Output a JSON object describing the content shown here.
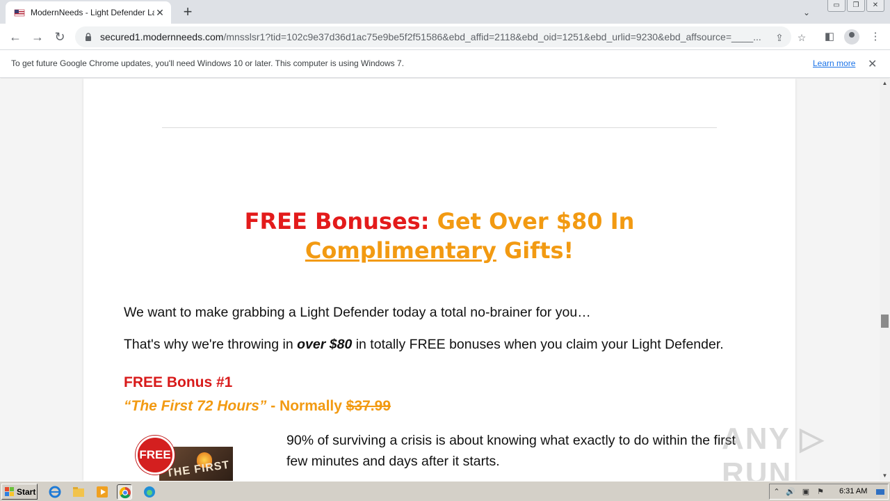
{
  "browser": {
    "tab": {
      "title": "ModernNeeds - Light Defender Laser",
      "close": "✕"
    },
    "new_tab": "+",
    "window_buttons": [
      "▭",
      "❐",
      "✕"
    ],
    "tab_search": "⌄",
    "nav": {
      "back": "←",
      "forward": "→",
      "reload": "↻"
    },
    "url": {
      "host": "secured1.modernneeds.com",
      "path": "/mnsslsr1?tid=102c9e37d36d1ac75e9be5f2f51586&ebd_affid=2118&ebd_oid=1251&ebd_urlid=9230&ebd_affsource=____..."
    },
    "icons": {
      "share": "⇪",
      "bookmark": "☆",
      "sidepanel": "◧",
      "menu": "⋮"
    }
  },
  "infobar": {
    "message": "To get future Google Chrome updates, you'll need Windows 10 or later. This computer is using Windows 7.",
    "link": "Learn more",
    "close": "✕"
  },
  "page": {
    "headline": {
      "part1": "FREE Bonuses:",
      "part2": " Get Over $80 In ",
      "part3": "Complimentary",
      "part4": " Gifts!"
    },
    "p1": "We want to make grabbing a Light Defender today a total no-brainer for you…",
    "p2": {
      "before": "That's why we're throwing in ",
      "emph": "over $80",
      "after": " in totally FREE bonuses when you claim your Light Defender."
    },
    "bonus1": {
      "title": "FREE Bonus #1",
      "name": "“The First 72 Hours”",
      "normally": " - Normally ",
      "price": "$37.99",
      "badge": "FREE",
      "cover_text": "THE FIRST",
      "description": "90% of surviving a crisis is about knowing what exactly to do within the first few minutes and days after it starts."
    },
    "watermark": "ANY ▷ RUN"
  },
  "scrollbar": {
    "up": "▲",
    "down": "▼"
  },
  "taskbar": {
    "start": "Start",
    "clock": "6:31 AM",
    "tray": [
      "⌃",
      "🔊",
      "▣",
      "⚑"
    ]
  },
  "colors": {
    "headline_red": "#e31b1b",
    "headline_orange": "#f29a12",
    "bonus_red": "#d81a1a",
    "link_blue": "#1a73e8"
  }
}
